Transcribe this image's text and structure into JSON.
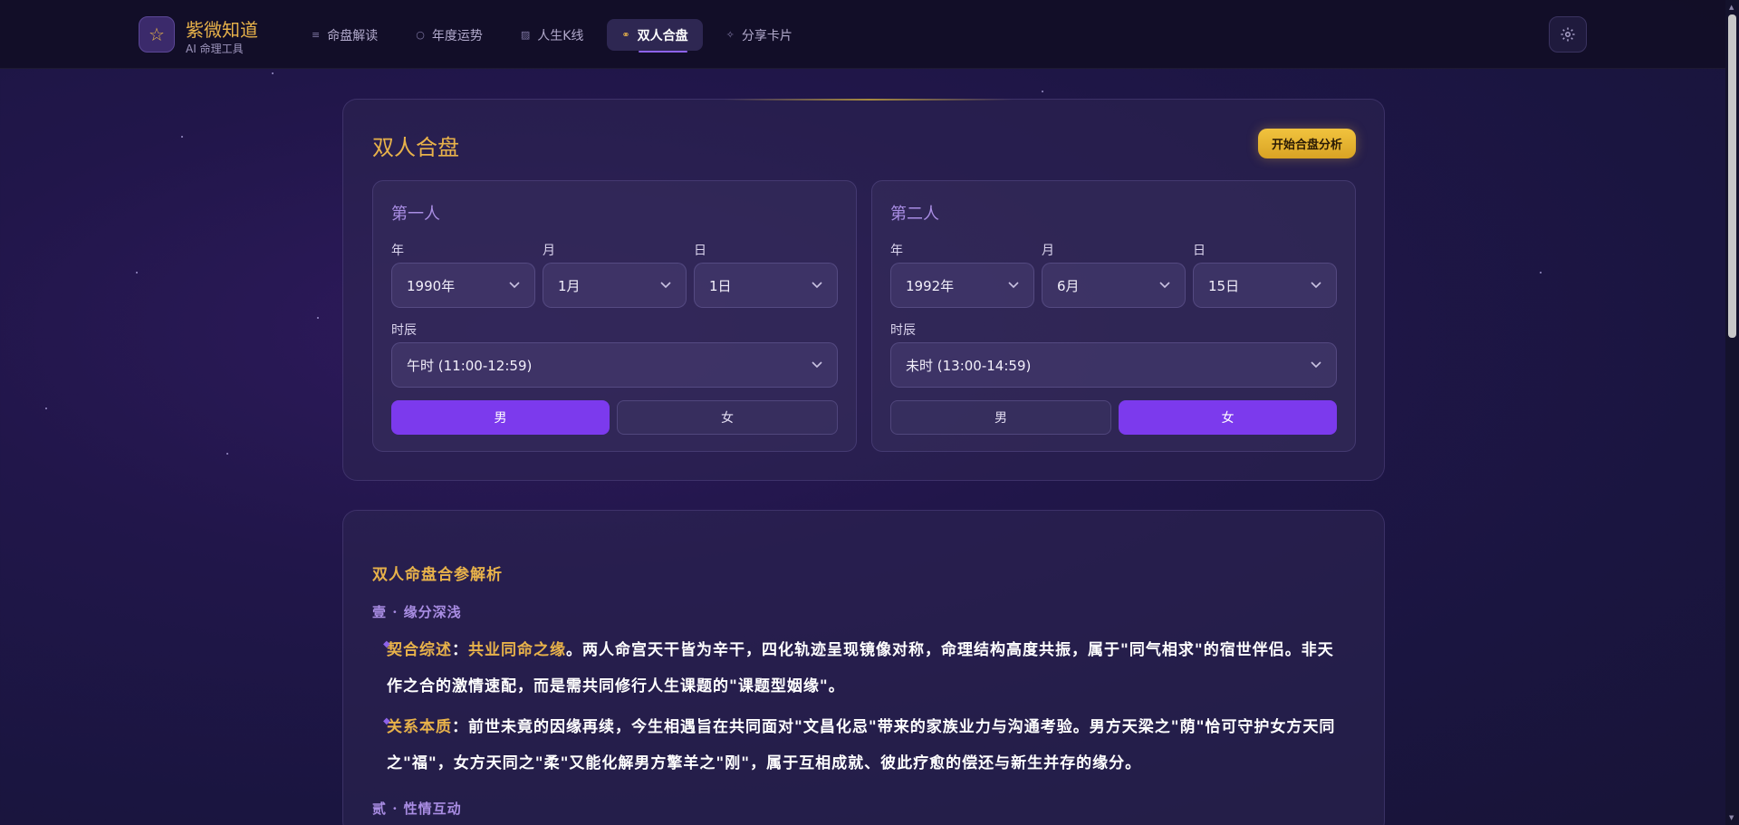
{
  "brand": {
    "title": "紫微知道",
    "subtitle": "AI 命理工具",
    "logo_icon": "star-icon"
  },
  "nav": [
    {
      "label": "命盘解读",
      "icon": "≡",
      "active": false
    },
    {
      "label": "年度运势",
      "icon": "○",
      "active": false
    },
    {
      "label": "人生K线",
      "icon": "▨",
      "active": false
    },
    {
      "label": "双人合盘",
      "icon": "⚭",
      "active": true
    },
    {
      "label": "分享卡片",
      "icon": "✧",
      "active": false
    }
  ],
  "settings_icon": "gear-icon",
  "form": {
    "title": "双人合盘",
    "submit_label": "开始合盘分析",
    "labels": {
      "year": "年",
      "month": "月",
      "day": "日",
      "hour": "时辰"
    },
    "person1": {
      "title": "第一人",
      "year": "1990年",
      "month": "1月",
      "day": "1日",
      "hour": "午时 (11:00-12:59)",
      "male": "男",
      "female": "女",
      "selected_gender": "男"
    },
    "person2": {
      "title": "第二人",
      "year": "1992年",
      "month": "6月",
      "day": "15日",
      "hour": "未时 (13:00-14:59)",
      "male": "男",
      "female": "女",
      "selected_gender": "女"
    }
  },
  "analysis": {
    "title": "双人命盘合参解析",
    "sections": [
      {
        "title": "壹 · 缘分深浅",
        "items": [
          {
            "label": "契合综述",
            "sep": "：",
            "highlight": "共业同命之缘",
            "text": "。两人命宫天干皆为辛干，四化轨迹呈现镜像对称，命理结构高度共振，属于\"同气相求\"的宿世伴侣。非天作之合的激情速配，而是需共同修行人生课题的\"课题型姻缘\"。"
          },
          {
            "label": "关系本质",
            "sep": "：",
            "highlight": "",
            "text": "前世未竟的因缘再续，今生相遇旨在共同面对\"文昌化忌\"带来的家族业力与沟通考验。男方天梁之\"荫\"恰可守护女方天同之\"福\"，女方天同之\"柔\"又能化解男方擎羊之\"刚\"，属于互相成就、彼此疗愈的偿还与新生并存的缘分。"
          }
        ]
      },
      {
        "title": "贰 · 性情互动",
        "items": []
      }
    ]
  },
  "colors": {
    "accent_gold": "#e8b24a",
    "accent_purple": "#7c3aed",
    "section_purple": "#a98de3"
  }
}
